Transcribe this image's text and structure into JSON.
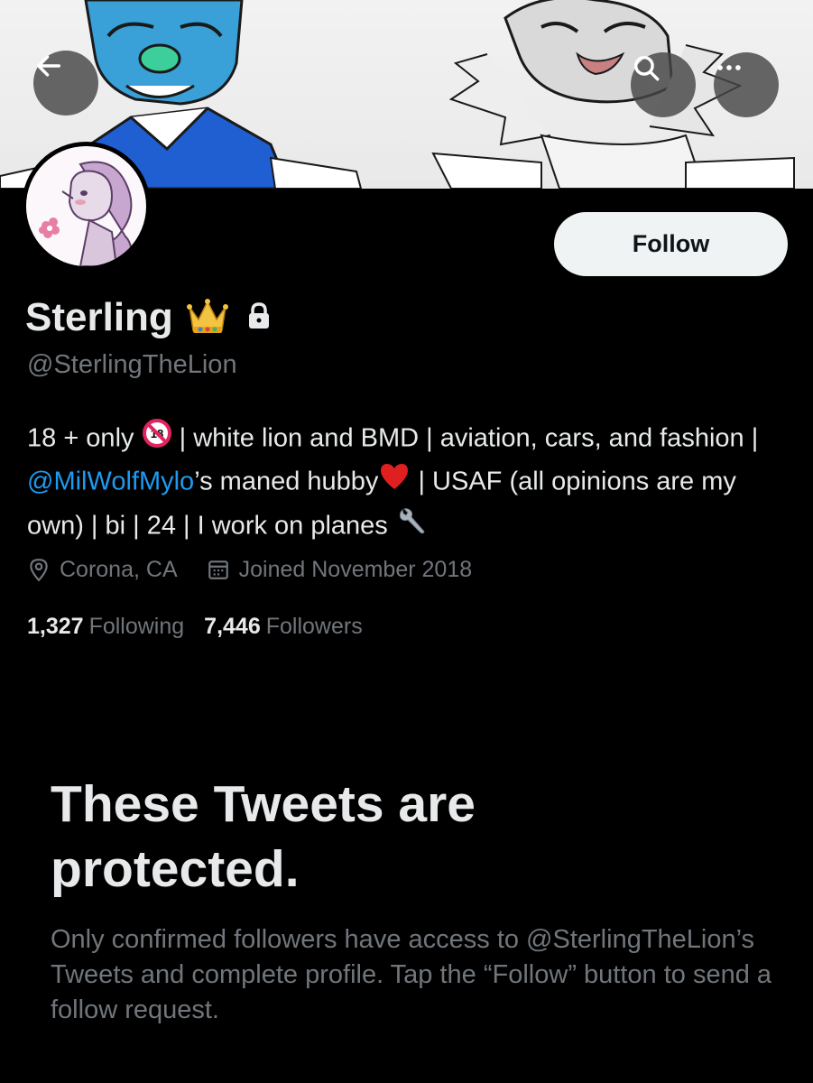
{
  "profile": {
    "display_name": "Sterling",
    "handle": "@SterlingTheLion",
    "bio": {
      "part1": "18 + only",
      "part2": " | white lion and BMD | aviation, cars, and fashion | ",
      "mention": "@MilWolfMylo",
      "part3": "’s maned hubby",
      "part4": " | USAF (all opinions are my own) | bi | 24 | I work on planes"
    },
    "location": "Corona, CA",
    "joined": "Joined November 2018",
    "following_count": "1,327",
    "following_label": "Following",
    "followers_count": "7,446",
    "followers_label": "Followers"
  },
  "actions": {
    "follow_label": "Follow"
  },
  "protected": {
    "title": "These Tweets are protected.",
    "description": "Only confirmed followers have access to @SterlingTheLion’s Tweets and complete profile. Tap the “Follow” button to send a follow request."
  },
  "icons": {
    "back": "arrow-left-icon",
    "search": "search-icon",
    "more": "more-icon",
    "location": "location-pin-icon",
    "calendar": "calendar-icon",
    "lock": "lock-icon",
    "crown": "crown-emoji",
    "no_under_18": "no-under-18-emoji",
    "heart": "red-heart-emoji",
    "wrench": "wrench-emoji"
  },
  "colors": {
    "background": "#000000",
    "primary_text": "#e7e9ea",
    "secondary_text": "#71767b",
    "link": "#1d9bf0",
    "follow_button_bg": "#eff3f4",
    "follow_button_text": "#0f1419"
  }
}
